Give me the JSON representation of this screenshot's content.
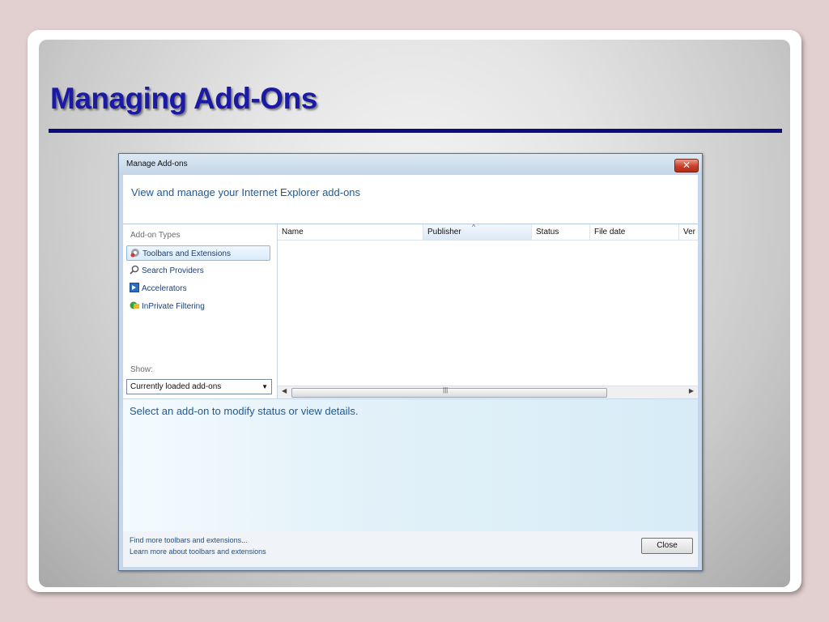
{
  "slide": {
    "title": "Managing Add-Ons"
  },
  "dialog": {
    "title": "Manage Add-ons",
    "close_glyph": "✕",
    "header_text": "View and manage your Internet Explorer add-ons",
    "addon_types_label": "Add-on Types",
    "addon_types": [
      {
        "label": "Toolbars and Extensions",
        "icon": "gear-icon",
        "selected": true
      },
      {
        "label": "Search Providers",
        "icon": "search-icon",
        "selected": false
      },
      {
        "label": "Accelerators",
        "icon": "accelerator-icon",
        "selected": false
      },
      {
        "label": "InPrivate Filtering",
        "icon": "inprivate-icon",
        "selected": false
      }
    ],
    "show_label": "Show:",
    "show_selected": "Currently loaded add-ons",
    "columns": [
      "Name",
      "Publisher",
      "Status",
      "File date",
      "Ver"
    ],
    "sorted_column": "Publisher",
    "details_text": "Select an add-on to modify status or view details.",
    "footer_links": [
      "Find more toolbars and extensions...",
      "Learn more about toolbars and extensions"
    ],
    "close_button_label": "Close"
  },
  "colors": {
    "title_blue": "#1a1aa6",
    "rule_navy": "#0c0c7a",
    "header_text_blue": "#1e5a96"
  }
}
